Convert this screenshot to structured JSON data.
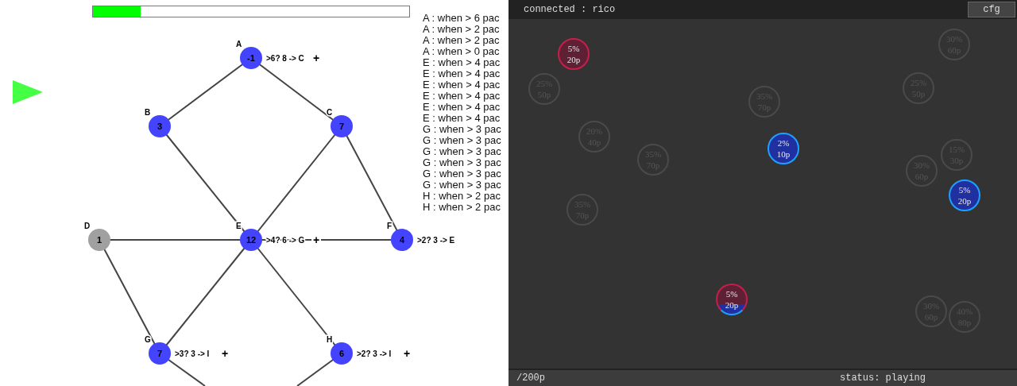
{
  "progress": {
    "level": 0.15
  },
  "graph": {
    "nodes": [
      {
        "label": "A",
        "value": "-1",
        "active": true,
        "rule": ">6? 8 -> C",
        "action": "+"
      },
      {
        "label": "B",
        "value": "3",
        "active": true
      },
      {
        "label": "C",
        "value": "7",
        "active": true
      },
      {
        "label": "D",
        "value": "1",
        "active": false
      },
      {
        "label": "E",
        "value": "12",
        "active": true,
        "rule": ">4? 6 -> G",
        "action": "+"
      },
      {
        "label": "F",
        "value": "4",
        "active": true,
        "rule": ">2? 3 -> E"
      },
      {
        "label": "G",
        "value": "7",
        "active": true,
        "rule": ">3? 3 -> I",
        "action": "+"
      },
      {
        "label": "H",
        "value": "6",
        "active": true,
        "rule": ">2? 3 -> I",
        "action": "+"
      }
    ]
  },
  "rules": [
    "A : when > 6 pac",
    "A : when > 2 pac",
    "A : when > 2 pac",
    "A : when > 0 pac",
    "E : when > 4 pac",
    "E : when > 4 pac",
    "E : when > 4 pac",
    "E : when > 4 pac",
    "E : when > 4 pac",
    "E : when > 4 pac",
    "G : when > 3 pac",
    "G : when > 3 pac",
    "G : when > 3 pac",
    "G : when > 3 pac",
    "G : when > 3 pac",
    "G : when > 3 pac",
    "H : when > 2 pac",
    "H : when > 2 pac"
  ],
  "header": {
    "status": "connected : rico",
    "button": "cfg"
  },
  "tokens": [
    {
      "kind": "neutral",
      "percent": "30%",
      "points": "60p"
    },
    {
      "kind": "red",
      "percent": "5%",
      "points": "20p"
    },
    {
      "kind": "neutral",
      "percent": "25%",
      "points": "50p"
    },
    {
      "kind": "neutral",
      "percent": "25%",
      "points": "50p"
    },
    {
      "kind": "neutral",
      "percent": "35%",
      "points": "70p"
    },
    {
      "kind": "neutral",
      "percent": "20%",
      "points": "40p"
    },
    {
      "kind": "blue",
      "percent": "2%",
      "points": "10p"
    },
    {
      "kind": "neutral",
      "percent": "15%",
      "points": "30p"
    },
    {
      "kind": "neutral",
      "percent": "35%",
      "points": "70p"
    },
    {
      "kind": "neutral",
      "percent": "30%",
      "points": "60p"
    },
    {
      "kind": "blue",
      "percent": "5%",
      "points": "20p"
    },
    {
      "kind": "neutral",
      "percent": "35%",
      "points": "70p"
    },
    {
      "kind": "split",
      "percent": "5%",
      "points": "20p"
    },
    {
      "kind": "neutral",
      "percent": "30%",
      "points": "60p"
    },
    {
      "kind": "neutral",
      "percent": "40%",
      "points": "80p"
    }
  ],
  "footer": {
    "points": "/200p",
    "status": "status: playing"
  }
}
